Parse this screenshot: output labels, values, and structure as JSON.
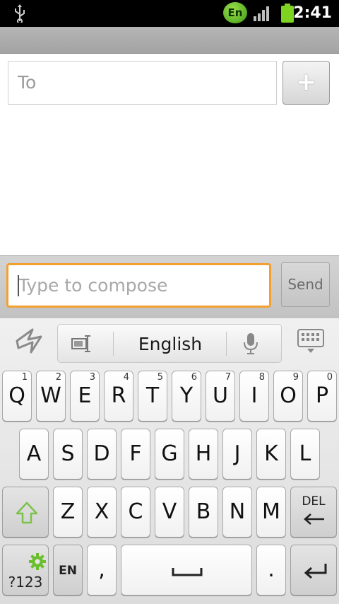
{
  "status_bar": {
    "time": "2:41",
    "input_language_badge": "En",
    "icons": [
      "usb-icon",
      "signal-icon",
      "battery-icon"
    ],
    "colors": {
      "badge": "#6cc22b",
      "battery": "#7ed321"
    }
  },
  "recipient": {
    "placeholder": "To",
    "add_label": "+"
  },
  "compose": {
    "placeholder": "Type to compose",
    "send_label": "Send",
    "focus_color": "#f4a030"
  },
  "keyboard": {
    "language": "English",
    "row1": [
      {
        "ch": "Q",
        "num": "1"
      },
      {
        "ch": "W",
        "num": "2"
      },
      {
        "ch": "E",
        "num": "3"
      },
      {
        "ch": "R",
        "num": "4"
      },
      {
        "ch": "T",
        "num": "5"
      },
      {
        "ch": "Y",
        "num": "6"
      },
      {
        "ch": "U",
        "num": "7"
      },
      {
        "ch": "I",
        "num": "8"
      },
      {
        "ch": "O",
        "num": "9"
      },
      {
        "ch": "P",
        "num": "0"
      }
    ],
    "row2": [
      "A",
      "S",
      "D",
      "F",
      "G",
      "H",
      "J",
      "K",
      "L"
    ],
    "row3": [
      "Z",
      "X",
      "C",
      "V",
      "B",
      "N",
      "M"
    ],
    "del_label": "DEL",
    "symbols_label": "?123",
    "lang_key_label": "EN",
    "comma_label": ",",
    "period_label": "."
  }
}
